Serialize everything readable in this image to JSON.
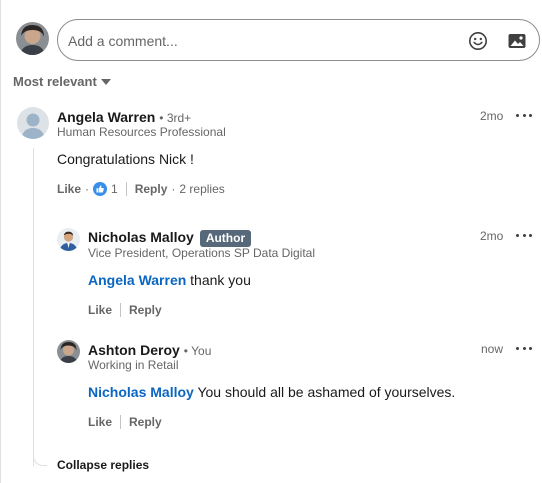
{
  "composer": {
    "placeholder": "Add a comment...",
    "emoji_icon": "emoji-smile-icon",
    "image_icon": "image-icon"
  },
  "sort": {
    "label": "Most relevant"
  },
  "comment": {
    "author": "Angela Warren",
    "degree": "• 3rd+",
    "headline": "Human Resources Professional",
    "time": "2mo",
    "text": "Congratulations Nick !",
    "like_label": "Like",
    "like_separator": "·",
    "like_count": "1",
    "reply_label": "Reply",
    "reply_separator": "·",
    "replies_count": "2 replies"
  },
  "replies": [
    {
      "author": "Nicholas Malloy",
      "badge": "Author",
      "headline": "Vice President, Operations SP Data Digital",
      "time": "2mo",
      "mention": "Angela Warren",
      "text": " thank you",
      "like_label": "Like",
      "reply_label": "Reply"
    },
    {
      "author": "Ashton Deroy",
      "degree": "• You",
      "headline": "Working in Retail",
      "time": "now",
      "mention": "Nicholas Malloy",
      "text": " You should all be ashamed of yourselves.",
      "like_label": "Like",
      "reply_label": "Reply"
    }
  ],
  "collapse_label": "Collapse replies",
  "colors": {
    "link": "#0a66c2",
    "badge_bg": "#56687a",
    "muted": "#666666"
  }
}
